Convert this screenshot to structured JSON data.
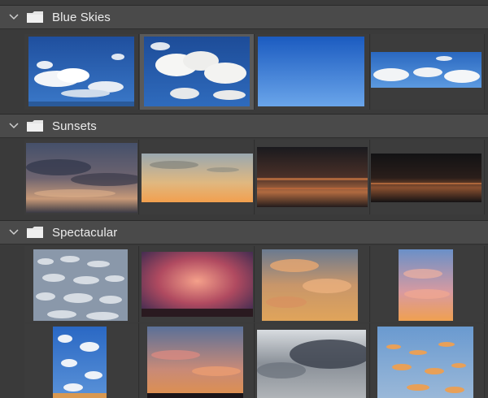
{
  "groups": [
    {
      "title": "Blue Skies",
      "items": [
        {
          "name": "blue-sky-clouds-1",
          "icon": "cloud-image"
        },
        {
          "name": "blue-sky-clouds-2",
          "icon": "cloud-image"
        },
        {
          "name": "clear-blue-sky",
          "icon": "sky-image"
        },
        {
          "name": "blue-sky-horizon",
          "icon": "cloud-image"
        }
      ]
    },
    {
      "title": "Sunsets",
      "items": [
        {
          "name": "sunset-1",
          "icon": "sunset-image"
        },
        {
          "name": "sunset-2",
          "icon": "sunset-image"
        },
        {
          "name": "sunset-3",
          "icon": "sunset-image"
        },
        {
          "name": "sunset-4",
          "icon": "sunset-image"
        }
      ]
    },
    {
      "title": "Spectacular",
      "items": [
        {
          "name": "spectacular-1",
          "icon": "cloud-image"
        },
        {
          "name": "spectacular-2",
          "icon": "sunset-image"
        },
        {
          "name": "spectacular-3",
          "icon": "sunset-image"
        },
        {
          "name": "spectacular-4",
          "icon": "sunset-image"
        },
        {
          "name": "spectacular-5",
          "icon": "cloud-image"
        },
        {
          "name": "spectacular-6",
          "icon": "sunset-image"
        },
        {
          "name": "spectacular-7",
          "icon": "cloud-image"
        },
        {
          "name": "spectacular-8",
          "icon": "sunset-image"
        }
      ]
    }
  ],
  "colors": {
    "panel_bg": "#3a3a3a",
    "header_bg": "#4a4a4a",
    "text": "#e8e8e8",
    "selected_tile": "#5a5a5a"
  },
  "icons": {
    "chevron": "chevron-down-icon",
    "folder": "folder-icon"
  }
}
